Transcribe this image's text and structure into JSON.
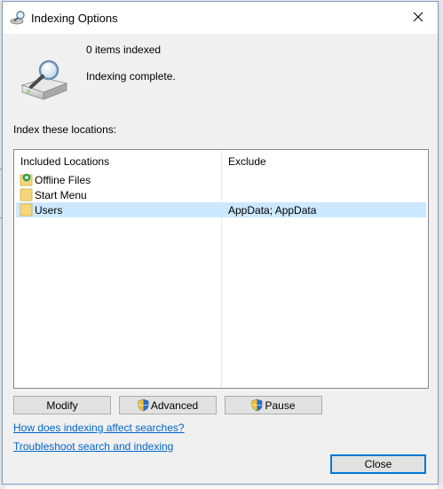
{
  "window": {
    "title": "Indexing Options",
    "title_icon": "indexing-magnifier-icon"
  },
  "status": {
    "items_indexed": "0 items indexed",
    "state": "Indexing complete."
  },
  "locations": {
    "section_label": "Index these locations:",
    "columns": {
      "included": "Included Locations",
      "exclude": "Exclude"
    },
    "rows": [
      {
        "name": "Offline Files",
        "exclude": "",
        "icon": "offline-folder-icon",
        "selected": false
      },
      {
        "name": "Start Menu",
        "exclude": "",
        "icon": "folder-icon",
        "selected": false
      },
      {
        "name": "Users",
        "exclude": "AppData; AppData",
        "icon": "folder-icon",
        "selected": true
      }
    ]
  },
  "buttons": {
    "modify": "Modify",
    "advanced": "Advanced",
    "pause": "Pause",
    "close": "Close"
  },
  "links": {
    "how_affects": "How does indexing affect searches?",
    "troubleshoot": "Troubleshoot search and indexing"
  },
  "colors": {
    "selection": "#cce8ff",
    "link": "#0066cc",
    "accent": "#0078d7"
  }
}
